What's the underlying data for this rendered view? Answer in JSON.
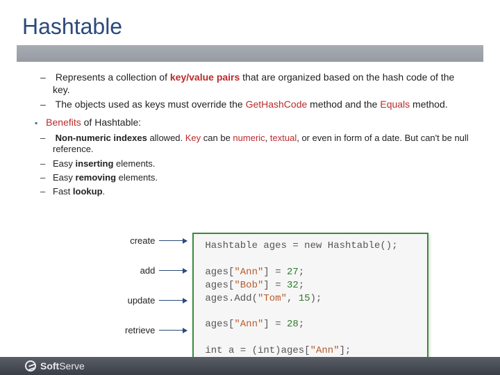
{
  "title": "Hashtable",
  "intro": {
    "li1_a": "Represents a collection of ",
    "li1_b": "key/value pairs",
    "li1_c": " that are organized based on the hash code of the key.",
    "li2_a": "The objects used as keys must override the ",
    "li2_b": "GetHashCode",
    "li2_c": " method and the ",
    "li2_d": "Equals",
    "li2_e": " method."
  },
  "benefits_label_a": "Benefits",
  "benefits_label_b": " of Hashtable:",
  "benefits": {
    "b1_a": "Non-numeric indexes",
    "b1_b": " allowed. ",
    "b1_c": "Key",
    "b1_d": " can be ",
    "b1_e": "numeric",
    "b1_f": ", ",
    "b1_g": "textual",
    "b1_h": ", or even in form of a date. But can't be null reference.",
    "b2_a": "Easy ",
    "b2_b": "inserting",
    "b2_c": " elements.",
    "b3_a": "Easy ",
    "b3_b": "removing",
    "b3_c": " elements.",
    "b4_a": "Fast ",
    "b4_b": "lookup",
    "b4_c": "."
  },
  "labels": {
    "create": "create",
    "add": "add",
    "update": "update",
    "retrieve": "retrieve"
  },
  "code": {
    "l1a": "Hashtable ages = new Hashtable();",
    "l3a": "ages[",
    "l3b": "\"Ann\"",
    "l3c": "] = ",
    "l3d": "27",
    "l3e": ";",
    "l4a": "ages[",
    "l4b": "\"Bob\"",
    "l4c": "] = ",
    "l4d": "32",
    "l4e": ";",
    "l5a": "ages.Add(",
    "l5b": "\"Tom\"",
    "l5c": ", ",
    "l5d": "15",
    "l5e": ");",
    "l7a": "ages[",
    "l7b": "\"Ann\"",
    "l7c": "] = ",
    "l7d": "28",
    "l7e": ";",
    "l9a": "int a = (int)ages[",
    "l9b": "\"Ann\"",
    "l9c": "];"
  },
  "brand_a": "Soft",
  "brand_b": "Serve"
}
